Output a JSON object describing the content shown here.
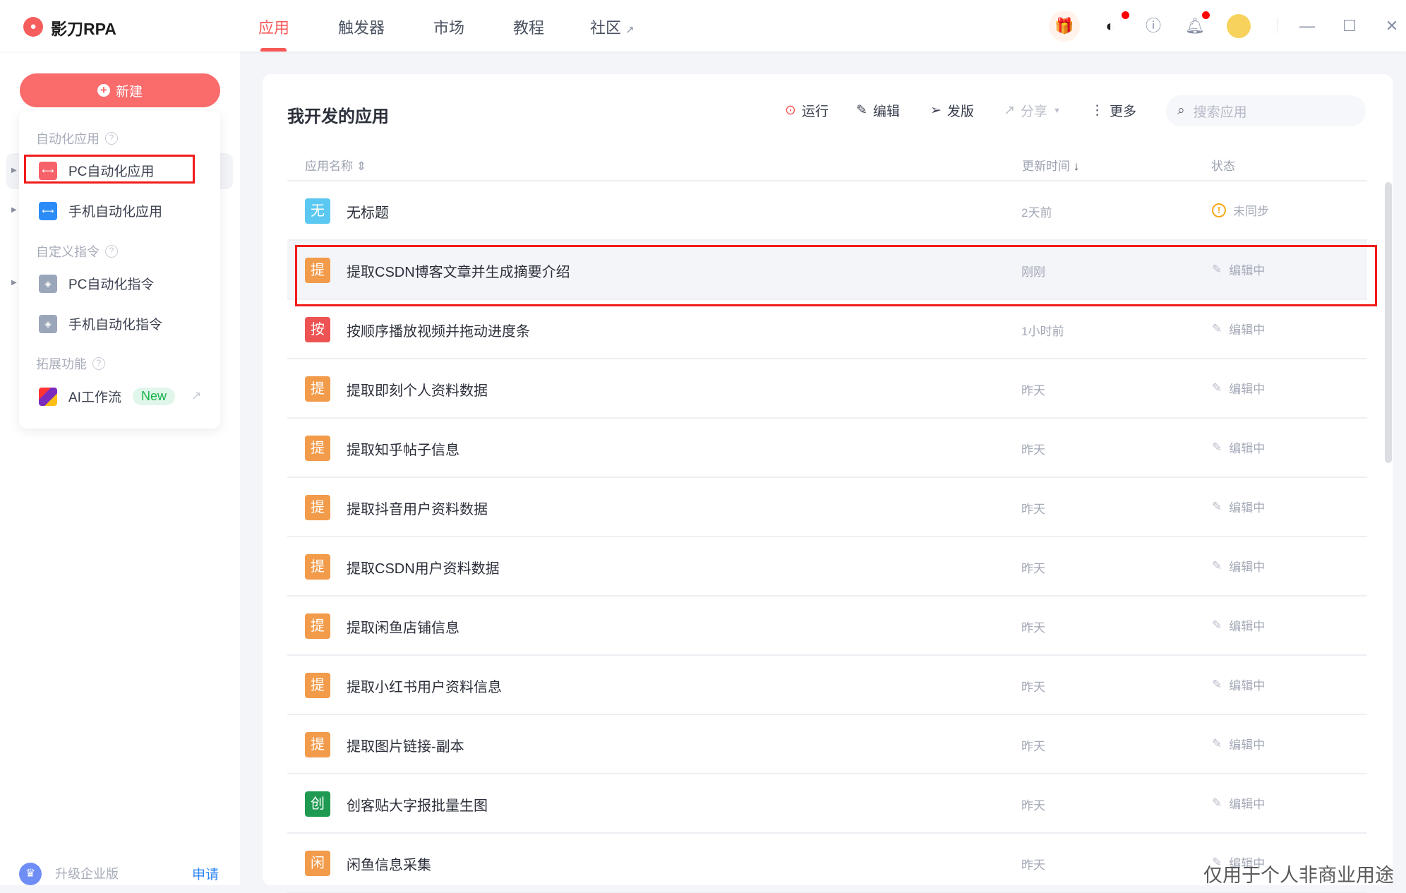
{
  "app": {
    "name": "影刀RPA"
  },
  "nav": [
    {
      "label": "应用",
      "active": true
    },
    {
      "label": "触发器"
    },
    {
      "label": "市场"
    },
    {
      "label": "教程"
    },
    {
      "label": "社区"
    }
  ],
  "sidebar": {
    "new_button": "新建",
    "popup": {
      "sections": [
        {
          "header": "自动化应用",
          "items": [
            {
              "label": "PC自动化应用",
              "color": "#f7616a"
            },
            {
              "label": "手机自动化应用",
              "color": "#2b8cf7"
            }
          ]
        },
        {
          "header": "自定义指令",
          "items": [
            {
              "label": "PC自动化指令",
              "color": "#9aa6ba"
            },
            {
              "label": "手机自动化指令",
              "color": "#9aa6ba"
            }
          ]
        },
        {
          "header": "拓展功能",
          "items": [
            {
              "label": "AI工作流",
              "badge": "New"
            }
          ]
        }
      ]
    },
    "upgrade": {
      "label": "升级企业版",
      "action": "申请"
    }
  },
  "main": {
    "title": "我开发的应用",
    "toolbar": {
      "run": "运行",
      "edit": "编辑",
      "publish": "发版",
      "share": "分享",
      "more": "更多"
    },
    "search_placeholder": "搜索应用",
    "columns": {
      "name": "应用名称",
      "time": "更新时间",
      "status": "状态"
    },
    "rows": [
      {
        "icon": "无",
        "color": "#5bc8f2",
        "name": "无标题",
        "time": "2天前",
        "status": "未同步",
        "warn": true
      },
      {
        "icon": "提",
        "color": "#f29b4a",
        "name": "提取CSDN博客文章并生成摘要介绍",
        "time": "刚刚",
        "status": "编辑中",
        "highlight": true
      },
      {
        "icon": "按",
        "color": "#ee5353",
        "name": "按顺序播放视频并拖动进度条",
        "time": "1小时前",
        "status": "编辑中"
      },
      {
        "icon": "提",
        "color": "#f29b4a",
        "name": "提取即刻个人资料数据",
        "time": "昨天",
        "status": "编辑中"
      },
      {
        "icon": "提",
        "color": "#f29b4a",
        "name": "提取知乎帖子信息",
        "time": "昨天",
        "status": "编辑中"
      },
      {
        "icon": "提",
        "color": "#f29b4a",
        "name": "提取抖音用户资料数据",
        "time": "昨天",
        "status": "编辑中"
      },
      {
        "icon": "提",
        "color": "#f29b4a",
        "name": "提取CSDN用户资料数据",
        "time": "昨天",
        "status": "编辑中"
      },
      {
        "icon": "提",
        "color": "#f29b4a",
        "name": "提取闲鱼店铺信息",
        "time": "昨天",
        "status": "编辑中"
      },
      {
        "icon": "提",
        "color": "#f29b4a",
        "name": "提取小红书用户资料信息",
        "time": "昨天",
        "status": "编辑中"
      },
      {
        "icon": "提",
        "color": "#f29b4a",
        "name": "提取图片链接-副本",
        "time": "昨天",
        "status": "编辑中"
      },
      {
        "icon": "创",
        "color": "#1f9a52",
        "name": "创客贴大字报批量生图",
        "time": "昨天",
        "status": "编辑中"
      },
      {
        "icon": "闲",
        "color": "#f29b4a",
        "name": "闲鱼信息采集",
        "time": "昨天",
        "status": "编辑中"
      }
    ]
  },
  "watermark": "仅用于个人非商业用途"
}
